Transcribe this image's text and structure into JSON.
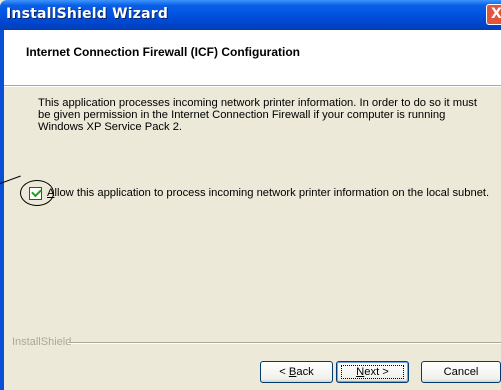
{
  "window": {
    "title": "InstallShield Wizard",
    "close_glyph": "X"
  },
  "header": {
    "title": "Internet Connection Firewall (ICF) Configuration"
  },
  "body": {
    "description": "This application processes incoming network printer information. In order to do so it must be given permission in the Internet Connection Firewall if your computer is running Windows XP Service Pack 2.",
    "checkbox_label_rest": "llow this application to process incoming network printer information on the local subnet.",
    "checkbox_label_accel": "A",
    "checkbox_checked": true
  },
  "footer": {
    "brand": "InstallShield",
    "back_accel": "B",
    "back_rest": "ack",
    "back_prefix": "< ",
    "next_accel": "N",
    "next_rest": "ext >",
    "cancel_label": "Cancel"
  },
  "icons": {
    "close": "close-icon",
    "check": "checkmark-icon"
  }
}
